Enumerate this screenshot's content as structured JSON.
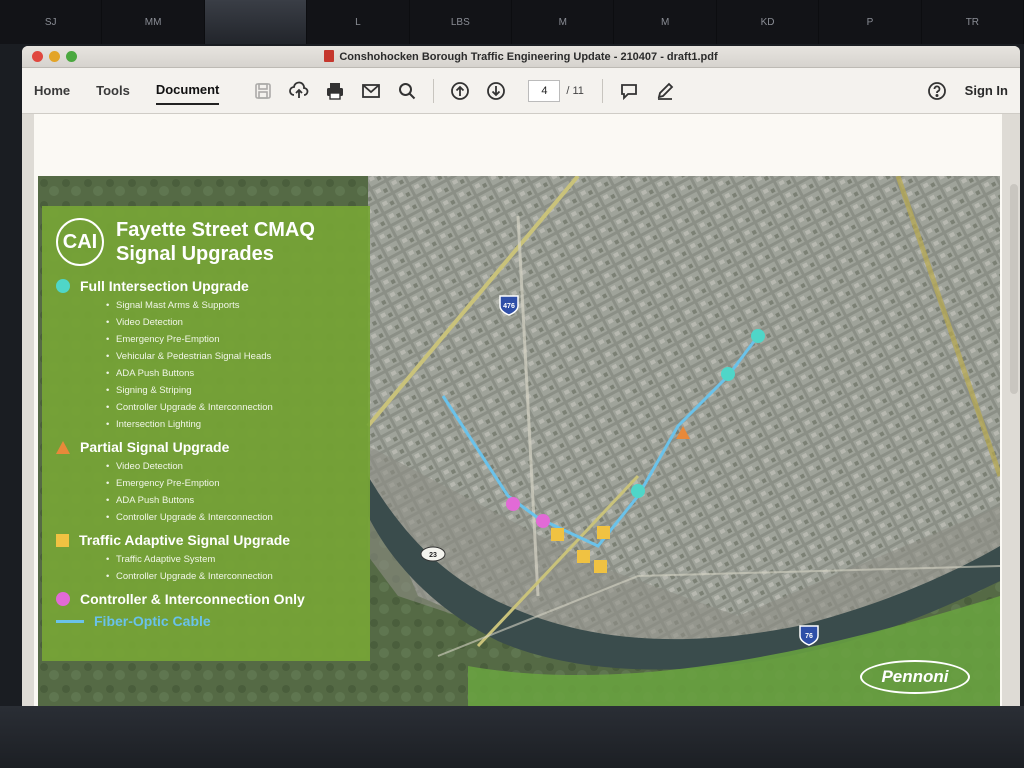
{
  "participants": [
    "SJ",
    "MM",
    "",
    "L",
    "LBS",
    "M",
    "M",
    "KD",
    "P",
    "TR"
  ],
  "window": {
    "title": "Conshohocken Borough Traffic Engineering Update - 210407 - draft1.pdf"
  },
  "toolbar": {
    "tabs": [
      "Home",
      "Tools",
      "Document"
    ],
    "active_tab": "Document",
    "tools": [
      "save-icon",
      "upload-icon",
      "print-icon",
      "mail-icon",
      "search-icon",
      "page-up-icon",
      "page-down-icon",
      "comment-icon",
      "pen-icon"
    ],
    "current_page": "4",
    "total_pages": "/ 11",
    "help_icon": "help-icon",
    "sign_in": "Sign In"
  },
  "slide": {
    "logo_text": "CAI",
    "title_line1": "Fayette Street CMAQ",
    "title_line2": "Signal Upgrades",
    "categories": [
      {
        "label": "Full Intersection Upgrade",
        "marker": "circle",
        "color": "#4fd6c8",
        "items": [
          "Signal Mast Arms & Supports",
          "Video Detection",
          "Emergency Pre-Emption",
          "Vehicular & Pedestrian Signal Heads",
          "ADA Push Buttons",
          "Signing & Striping",
          "Controller Upgrade & Interconnection",
          "Intersection Lighting"
        ]
      },
      {
        "label": "Partial Signal Upgrade",
        "marker": "triangle",
        "color": "#e8893a",
        "items": [
          "Video Detection",
          "Emergency Pre-Emption",
          "ADA Push Buttons",
          "Controller Upgrade & Interconnection"
        ]
      },
      {
        "label": "Traffic Adaptive Signal Upgrade",
        "marker": "square",
        "color": "#f0c242",
        "items": [
          "Traffic Adaptive System",
          "Controller Upgrade & Interconnection"
        ]
      },
      {
        "label": "Controller & Interconnection Only",
        "marker": "circle",
        "color": "#e26ad6",
        "items": []
      },
      {
        "label": "Fiber-Optic Cable",
        "marker": "line",
        "color": "#6ac2ea",
        "items": []
      }
    ],
    "map_shields": [
      "476",
      "76",
      "23"
    ],
    "brand": "Pennoni"
  }
}
